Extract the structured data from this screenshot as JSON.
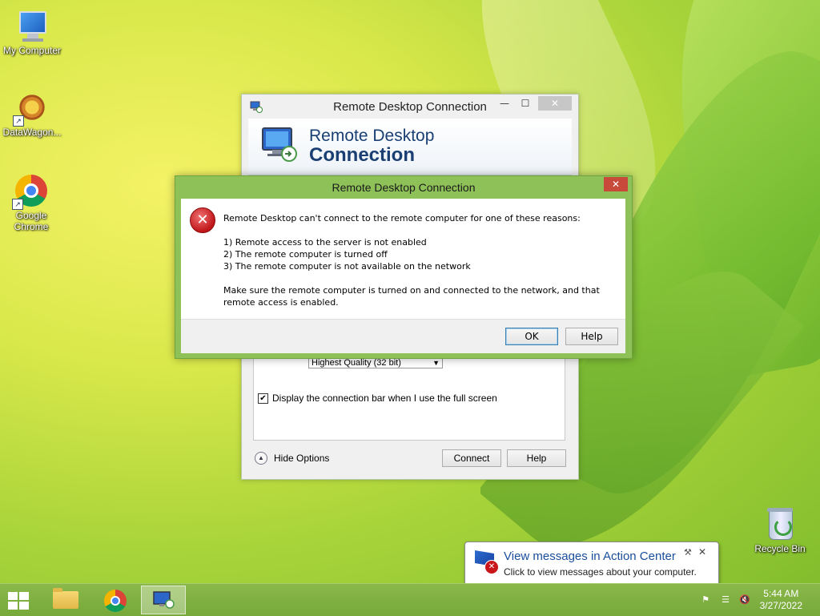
{
  "desktop": {
    "icons": [
      {
        "label": "My Computer",
        "icon": "computer-icon"
      },
      {
        "label": "DataWagon...",
        "icon": "datawagon-icon"
      },
      {
        "label": "Google Chrome",
        "icon": "chrome-icon"
      },
      {
        "label": "Recycle Bin",
        "icon": "recycle-bin-icon"
      }
    ]
  },
  "rdc_window": {
    "title": "Remote Desktop Connection",
    "banner_line1": "Remote Desktop",
    "banner_line2": "Connection",
    "color_depth_value": "Highest Quality (32 bit)",
    "checkbox_label": "Display the connection bar when I use the full screen",
    "checkbox_checked": true,
    "hide_options_label": "Hide Options",
    "connect_label": "Connect",
    "help_label": "Help",
    "controls": {
      "minimize": "—",
      "maximize": "☐",
      "close": "✕"
    }
  },
  "error_dialog": {
    "title": "Remote Desktop Connection",
    "close_glyph": "✕",
    "icon": "error-icon",
    "icon_glyph": "✕",
    "message_intro": "Remote Desktop can't connect to the remote computer for one of these reasons:",
    "reasons": [
      "1) Remote access to the server is not enabled",
      "2) The remote computer is turned off",
      "3) The remote computer is not available on the network"
    ],
    "message_outro": "Make sure the remote computer is turned on and connected to the network, and that remote access is enabled.",
    "ok_label": "OK",
    "help_label": "Help"
  },
  "notification": {
    "title": "View messages in Action Center",
    "subtitle": "Click to view messages about your computer.",
    "close_glyph": "✕",
    "wrench_glyph": "🔧"
  },
  "taskbar": {
    "items": [
      "start-button",
      "file-explorer",
      "google-chrome",
      "remote-desktop-connection"
    ],
    "clock_time": "5:44 AM",
    "clock_date": "3/27/2022"
  },
  "colors": {
    "dialog_frame": "#8ec158",
    "taskbar": "#7daf3f",
    "banner_text": "#1a3f73",
    "error_red": "#c0161a"
  }
}
